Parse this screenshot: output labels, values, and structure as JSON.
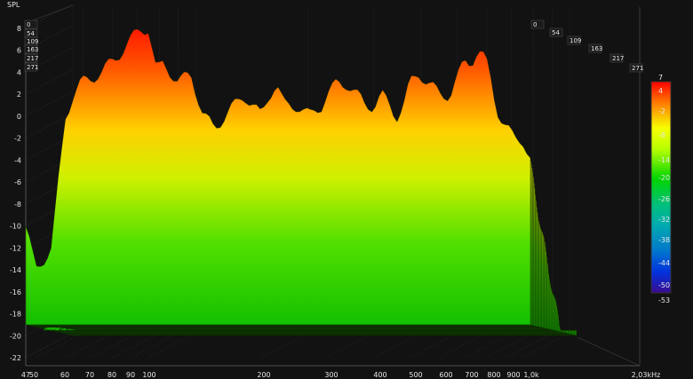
{
  "chart_data": {
    "type": "area",
    "title": "",
    "ylabel": "SPL",
    "xlabel": "",
    "x_scale": "log",
    "y_ticks": [
      8,
      6,
      4,
      2,
      0,
      -2,
      -4,
      -6,
      -8,
      -10,
      -12,
      -14,
      -16,
      -18,
      -20,
      -22
    ],
    "x_ticks": [
      "47",
      "50",
      "60",
      "70",
      "80",
      "90",
      "100",
      "200",
      "300",
      "400",
      "500",
      "600",
      "700",
      "800",
      "900",
      "1,0k",
      "2,03kHz"
    ],
    "depth_labels_left": [
      "0",
      "54",
      "109",
      "163",
      "217",
      "271"
    ],
    "depth_labels_right": [
      "0",
      "54",
      "109",
      "163",
      "217",
      "271"
    ],
    "colorbar": {
      "ticks": [
        "7",
        "4",
        "-2",
        "-8",
        "-14",
        "-20",
        "-26",
        "-32",
        "-38",
        "-44",
        "-50",
        "-53"
      ],
      "colors": [
        "#ff0000",
        "#ff7a00",
        "#f7ff00",
        "#b8ff00",
        "#00d400",
        "#00c07a",
        "#00aab0",
        "#0077cc",
        "#0033dd",
        "#1a10b0",
        "#3a0a90"
      ]
    },
    "envelope": {
      "x_freq": [
        47,
        50,
        55,
        60,
        63,
        66,
        70,
        75,
        80,
        85,
        90,
        95,
        100,
        105,
        110,
        120,
        130,
        140,
        150,
        160,
        170,
        180,
        190,
        200,
        210,
        220,
        230,
        240,
        250,
        270,
        290,
        300,
        320,
        340,
        360,
        380,
        400,
        420,
        440,
        460,
        480,
        500,
        530,
        560,
        600,
        640,
        680,
        700,
        730,
        760,
        800,
        830,
        850,
        870,
        900,
        950,
        1000,
        1050
      ],
      "spl_front": [
        -10,
        -14,
        -12,
        0,
        2,
        3,
        3.5,
        4,
        5,
        6,
        7,
        8,
        8,
        4,
        5,
        3,
        4,
        0,
        -1,
        0,
        1,
        2,
        1,
        0,
        2,
        3,
        1,
        1,
        1,
        0,
        1,
        2,
        3,
        3,
        2,
        1,
        1,
        2,
        1,
        0,
        1,
        3,
        4,
        3,
        2,
        2,
        4,
        5,
        5,
        6,
        5,
        3,
        1,
        0,
        -1,
        -2,
        -2,
        -4
      ]
    }
  }
}
